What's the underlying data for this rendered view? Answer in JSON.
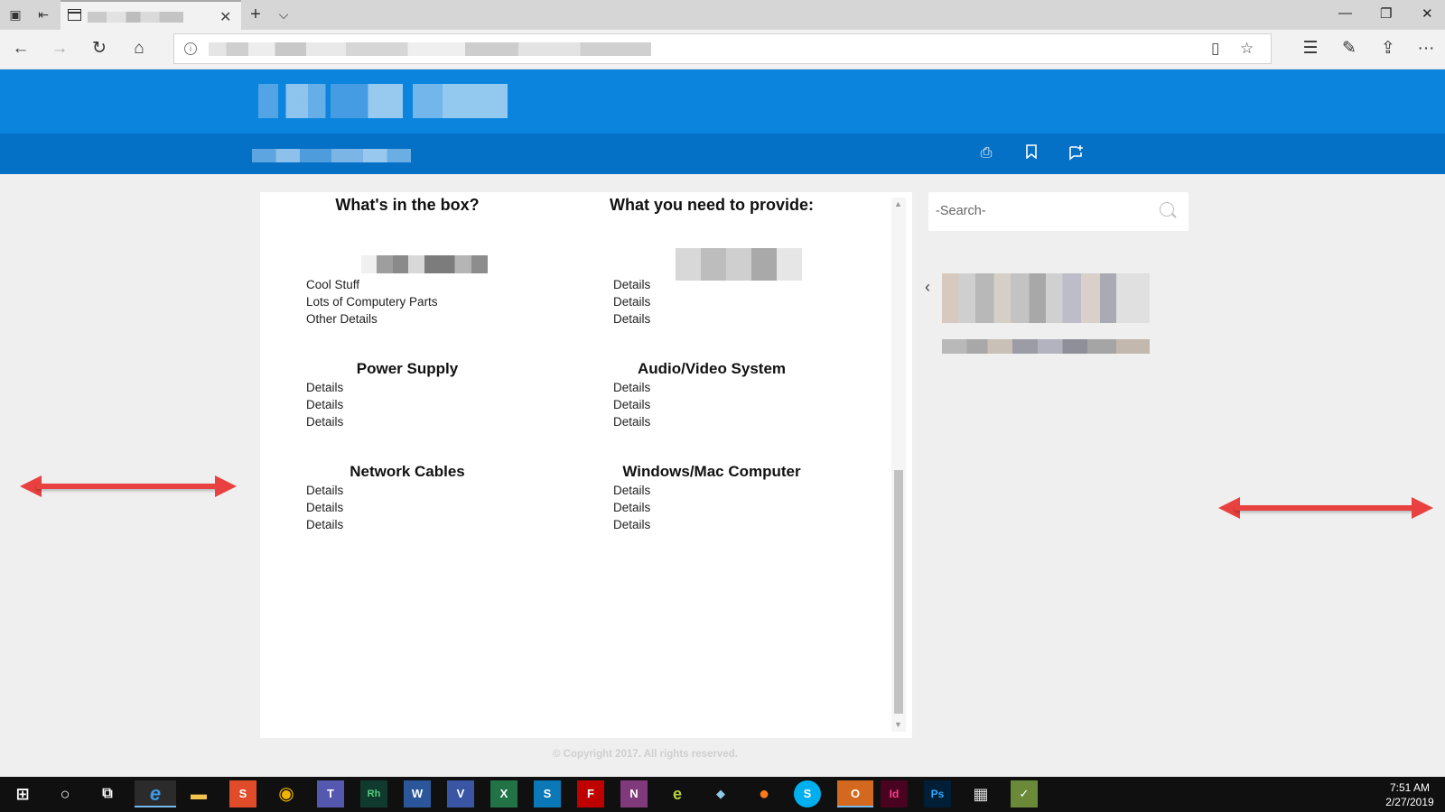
{
  "browser": {
    "tab_close": "✕",
    "new_tab": "+",
    "tab_menu": "⌵",
    "window_controls": {
      "minimize": "—",
      "restore": "❐",
      "close": "✕"
    },
    "nav": {
      "back": "←",
      "forward": "→",
      "refresh": "↻",
      "home": "⌂"
    },
    "url_info": "i",
    "toolbar": {
      "reading_view": "▯",
      "favorite": "☆",
      "favorites_list": "☰",
      "notes": "✎",
      "share": "⇪",
      "more": "···"
    }
  },
  "page_toolbar": {
    "print": "⎙",
    "bookmark": "🔖",
    "add_note": "+"
  },
  "columns": {
    "left": {
      "title": "What's in the box?",
      "items": [
        "Cool Stuff",
        "Lots of Computery Parts",
        "Other Details"
      ]
    },
    "right": {
      "title": "What you need to provide:",
      "items": [
        "Details",
        "Details",
        "Details"
      ]
    }
  },
  "sections": [
    {
      "title": "Power Supply",
      "items": [
        "Details",
        "Details",
        "Details"
      ]
    },
    {
      "title": "Audio/Video System",
      "items": [
        "Details",
        "Details",
        "Details"
      ]
    },
    {
      "title": "Network Cables",
      "items": [
        "Details",
        "Details",
        "Details"
      ]
    },
    {
      "title": "Windows/Mac Computer",
      "items": [
        "Details",
        "Details",
        "Details"
      ]
    }
  ],
  "sidebar": {
    "search_placeholder": "-Search-",
    "chevron": "‹"
  },
  "footer": {
    "copyright": "© Copyright 2017. All rights reserved."
  },
  "annotations": {
    "arrow_color": "#e8413f"
  },
  "taskbar": {
    "apps": [
      {
        "label": "⊞",
        "icon": "windows-start-icon"
      },
      {
        "label": "○",
        "icon": "cortana-icon"
      },
      {
        "label": "⧉",
        "icon": "task-view-icon"
      },
      {
        "label": "e",
        "icon": "edge-icon"
      },
      {
        "label": "▬",
        "icon": "file-explorer-icon"
      },
      {
        "label": "S",
        "icon": "snagit-icon"
      },
      {
        "label": "◉",
        "icon": "chrome-icon"
      },
      {
        "label": "T",
        "icon": "teams-icon"
      },
      {
        "label": "Rh",
        "icon": "robohelp-icon"
      },
      {
        "label": "W",
        "icon": "word-icon"
      },
      {
        "label": "V",
        "icon": "visio-icon"
      },
      {
        "label": "X",
        "icon": "excel-icon"
      },
      {
        "label": "S",
        "icon": "sharepoint-icon"
      },
      {
        "label": "F",
        "icon": "filezilla-icon"
      },
      {
        "label": "N",
        "icon": "onenote-icon"
      },
      {
        "label": "e",
        "icon": "captivate-icon"
      },
      {
        "label": "◆",
        "icon": "app-icon"
      },
      {
        "label": "●",
        "icon": "firefox-icon"
      },
      {
        "label": "S",
        "icon": "skype-icon"
      },
      {
        "label": "O",
        "icon": "outlook-icon"
      },
      {
        "label": "Id",
        "icon": "indesign-icon"
      },
      {
        "label": "Ps",
        "icon": "photoshop-icon"
      },
      {
        "label": "▦",
        "icon": "calculator-icon"
      },
      {
        "label": "✓",
        "icon": "project-icon"
      }
    ],
    "time": "7:51 AM",
    "date": "2/27/2019"
  }
}
